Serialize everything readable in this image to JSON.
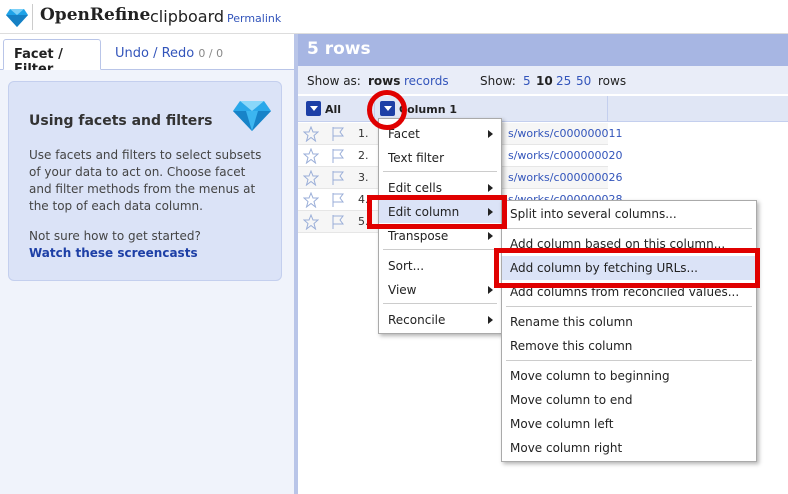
{
  "header": {
    "brand": "OpenRefine",
    "project_name": "clipboard",
    "permalink": "Permalink"
  },
  "left_panel": {
    "tabs": [
      {
        "label": "Facet / Filter"
      },
      {
        "label": "Undo / Redo",
        "count": "0 / 0"
      }
    ],
    "help": {
      "title": "Using facets and filters",
      "text": "Use facets and filters to select subsets of your data to act on. Choose facet and filter methods from the menus at the top of each data column.",
      "prompt": "Not sure how to get started?",
      "link": "Watch these screencasts"
    }
  },
  "summary": {
    "row_count": "5 rows",
    "show_as_label": "Show as:",
    "mode_rows": "rows",
    "mode_records": "records",
    "show_label": "Show:",
    "page_sizes": [
      "5",
      "10",
      "25",
      "50"
    ],
    "selected_page_size": "10",
    "rows_label": "rows"
  },
  "grid": {
    "all_label": "All",
    "column_label": "Column 1",
    "rows": [
      {
        "num": "1.",
        "value": "s/works/c000000011"
      },
      {
        "num": "2.",
        "value": "s/works/c000000020"
      },
      {
        "num": "3.",
        "value": "s/works/c000000026"
      },
      {
        "num": "4.",
        "value": "s/works/c000000028"
      },
      {
        "num": "5.",
        "value": ""
      }
    ]
  },
  "column_menu": {
    "items": [
      {
        "label": "Facet",
        "submenu": true
      },
      {
        "label": "Text filter",
        "submenu": false
      },
      {
        "label": "Edit cells",
        "submenu": true
      },
      {
        "label": "Edit column",
        "submenu": true,
        "highlighted": true
      },
      {
        "label": "Transpose",
        "submenu": true
      },
      {
        "label": "Sort...",
        "submenu": false
      },
      {
        "label": "View",
        "submenu": true
      },
      {
        "label": "Reconcile",
        "submenu": true
      }
    ]
  },
  "edit_column_submenu": {
    "items": [
      {
        "label": "Split into several columns..."
      },
      {
        "label": "Add column based on this column..."
      },
      {
        "label": "Add column by fetching URLs...",
        "highlighted": true
      },
      {
        "label": "Add columns from reconciled values..."
      },
      {
        "label": "Rename this column"
      },
      {
        "label": "Remove this column"
      },
      {
        "label": "Move column to beginning"
      },
      {
        "label": "Move column to end"
      },
      {
        "label": "Move column left"
      },
      {
        "label": "Move column right"
      }
    ]
  },
  "colors": {
    "accent": "#3355bb",
    "summary_bar": "#a7b6e3",
    "annotation_red": "#e00000"
  },
  "icons": [
    "diamond-logo-icon",
    "diamond-icon",
    "star-icon",
    "flag-icon",
    "chevron-down-icon",
    "chevron-right-icon"
  ]
}
